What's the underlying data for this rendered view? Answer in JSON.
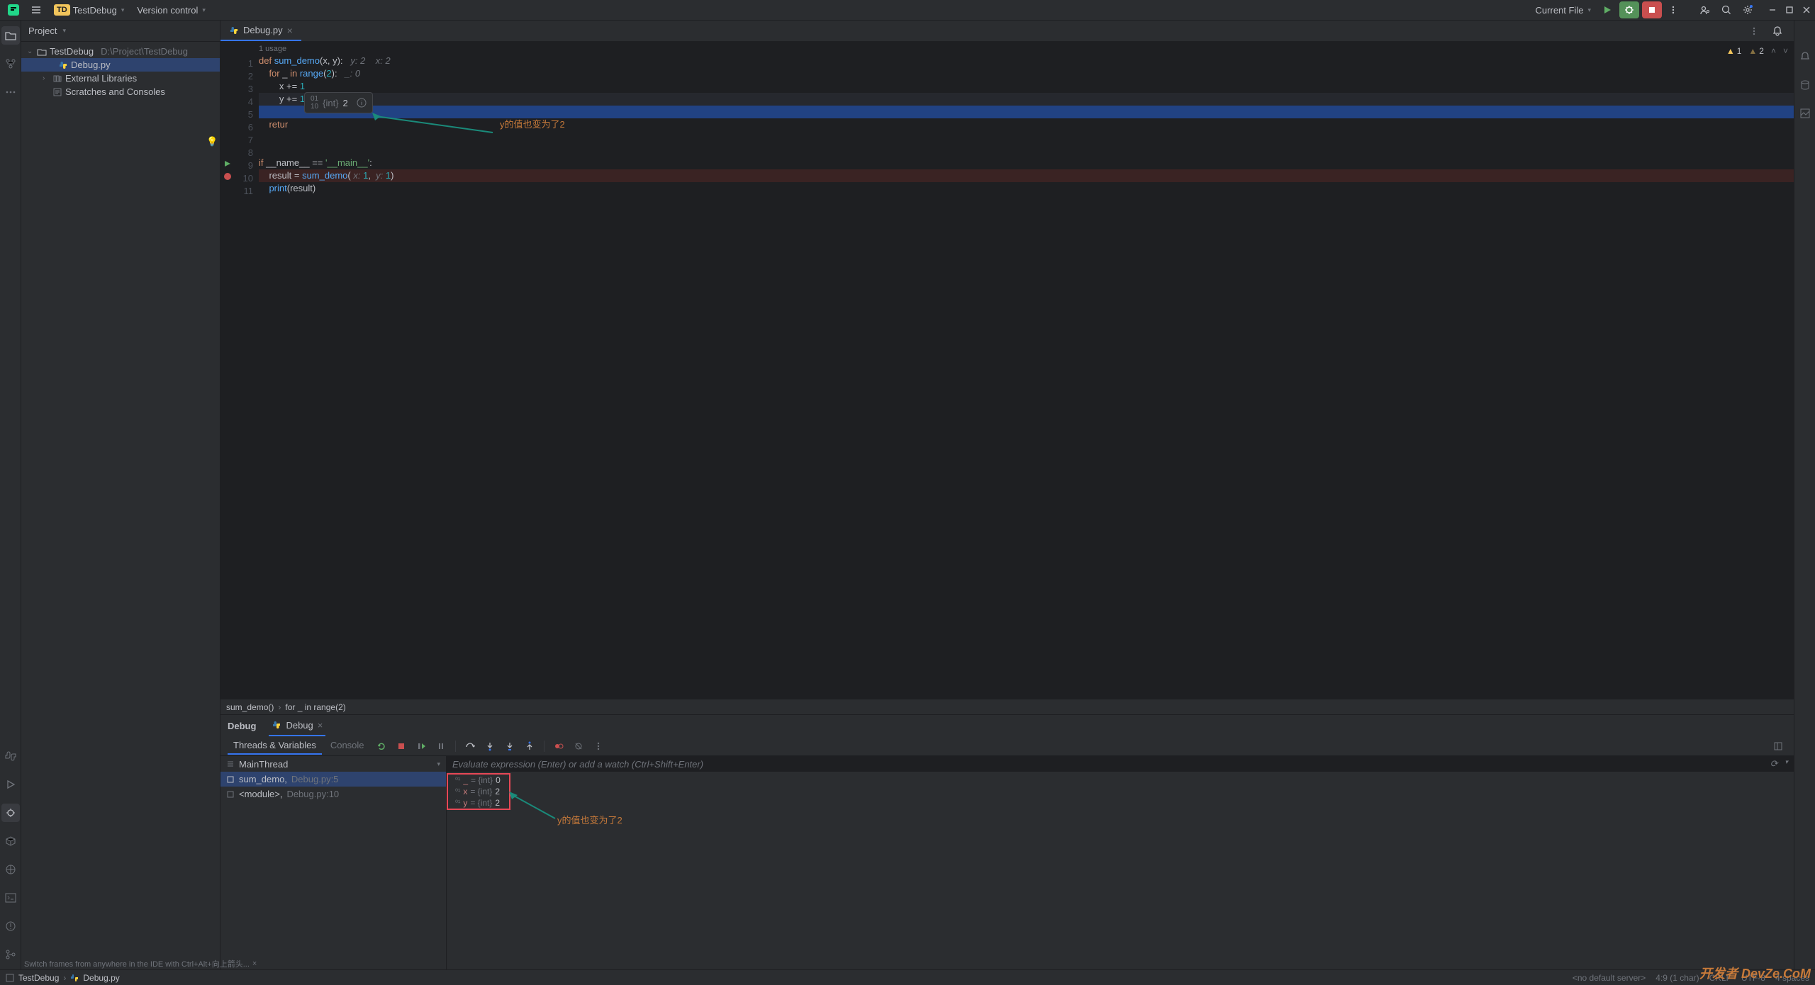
{
  "titlebar": {
    "project_badge": "TD",
    "project_name": "TestDebug",
    "vcs_label": "Version control",
    "run_config": "Current File"
  },
  "project_panel": {
    "title": "Project",
    "root_name": "TestDebug",
    "root_path": "D:\\Project\\TestDebug",
    "file1": "Debug.py",
    "ext_libs": "External Libraries",
    "scratches": "Scratches and Consoles"
  },
  "tabs": {
    "tab1": "Debug.py"
  },
  "editor": {
    "usage_hint": "1 usage",
    "warn1": "1",
    "warn2": "2",
    "lines": {
      "l1": "1",
      "l2": "2",
      "l3": "3",
      "l4": "4",
      "l5": "5",
      "l6": "6",
      "l7": "7",
      "l8": "8",
      "l9": "9",
      "l10": "10",
      "l11": "11"
    },
    "code": {
      "l1_def": "def ",
      "l1_fn": "sum_demo",
      "l1_open": "(",
      "l1_x": "x",
      "l1_c1": ", ",
      "l1_y": "y",
      "l1_close": "):   ",
      "l1_hy": "y: ",
      "l1_hy_v": "2",
      "l1_gap": "    ",
      "l1_hx": "x: ",
      "l1_hx_v": "2",
      "l2_for": "    for ",
      "l2_u": "_",
      "l2_in": " in ",
      "l2_range": "range",
      "l2_p": "(",
      "l2_2": "2",
      "l2_pc": "):   ",
      "l2_h": "_: ",
      "l2_hv": "0",
      "l3_x": "        x ",
      "l3_op": "+=",
      "l3_sp": " ",
      "l3_1": "1",
      "l4_y": "        y ",
      "l4_op": "+=",
      "l4_sp": " ",
      "l4_1": "1",
      "l5": "        ",
      "l6_ret": "    retur",
      "l9_if": "if ",
      "l9_name": "__name__",
      "l9_eq": " == ",
      "l9_str": "'__main__'",
      "l9_c": ":",
      "l10_ind": "    ",
      "l10_res": "result",
      "l10_eq": " = ",
      "l10_fn": "sum_demo",
      "l10_p": "( ",
      "l10_hx": "x: ",
      "l10_1": "1",
      "l10_c": ",  ",
      "l10_hy": "y: ",
      "l10_1b": "1",
      "l10_pc": ")",
      "l11_ind": "    ",
      "l11_print": "print",
      "l11_p": "(",
      "l11_res": "result",
      "l11_pc": ")"
    },
    "popup_type": "{int}",
    "popup_val": "2",
    "annot1": "y的值也变为了2"
  },
  "breadcrumb": {
    "b1": "sum_demo()",
    "b2": "for _ in range(2)"
  },
  "debug": {
    "tab_main": "Debug",
    "tab_sub": "Debug",
    "subtab1": "Threads & Variables",
    "subtab2": "Console",
    "thread": "MainThread",
    "frame1_a": "sum_demo,",
    "frame1_b": " Debug.py:5",
    "frame2_a": "<module>,",
    "frame2_b": " Debug.py:10",
    "eval_placeholder": "Evaluate expression (Enter) or add a watch (Ctrl+Shift+Enter)",
    "vars": {
      "u_name": "_",
      "u_type": " = {int} ",
      "u_val": "0",
      "x_name": "x",
      "x_type": " = {int} ",
      "x_val": "2",
      "y_name": "y",
      "y_type": " = {int} ",
      "y_val": "2"
    },
    "annot2": "y的值也变为了2",
    "hint": "Switch frames from anywhere in the IDE with Ctrl+Alt+向上箭头..."
  },
  "statusbar": {
    "proj": "TestDebug",
    "file": "Debug.py",
    "server": "<no default server>",
    "pos": "4:9 (1 char)",
    "crlf": "CRLF",
    "enc": "UTF-8",
    "indent": "4 spaces"
  },
  "watermark": "开发者 DevZe.CoM"
}
